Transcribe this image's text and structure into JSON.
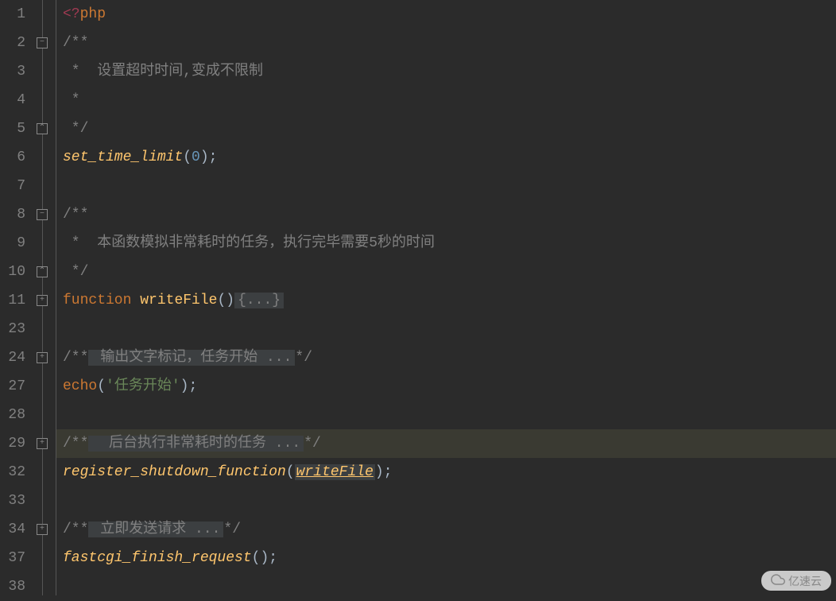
{
  "line_numbers": [
    "1",
    "2",
    "3",
    "4",
    "5",
    "6",
    "7",
    "8",
    "9",
    "10",
    "11",
    "23",
    "24",
    "27",
    "28",
    "29",
    "32",
    "33",
    "34",
    "37",
    "38"
  ],
  "code": {
    "phpopen": "<?php",
    "docblock_open": "/**",
    "comment_timeout": " *  设置超时时间,变成不限制",
    "comment_star": " *",
    "docblock_close": " */",
    "set_time_limit": "set_time_limit",
    "zero": "0",
    "comment_task": " *  本函数模拟非常耗时的任务，执行完毕需要5秒的时间",
    "function_kw": "function",
    "writeFile_fn": "writeFile",
    "folded_body": "{...}",
    "comment_inline1_fold": " 输出文字标记，任务开始 ...",
    "echo_kw": "echo",
    "echo_str": "'任务开始'",
    "comment_inline2_fold": "  后台执行非常耗时的任务 ...",
    "register_fn": "register_shutdown_function",
    "writeFile_ref": "writeFile",
    "comment_inline3_fold": " 立即发送请求 ...",
    "fastcgi_fn": "fastcgi_finish_request",
    "paren_open": "(",
    "paren_close": ")",
    "semi": ";",
    "doc_inline_open": "/**",
    "doc_inline_close": "*/"
  },
  "fold_markers": [
    {
      "row": 1,
      "type": "minus"
    },
    {
      "row": 4,
      "type": "end"
    },
    {
      "row": 7,
      "type": "minus"
    },
    {
      "row": 9,
      "type": "end"
    },
    {
      "row": 10,
      "type": "plus"
    },
    {
      "row": 12,
      "type": "plus"
    },
    {
      "row": 15,
      "type": "plus"
    },
    {
      "row": 18,
      "type": "plus"
    }
  ],
  "watermark": "亿速云"
}
